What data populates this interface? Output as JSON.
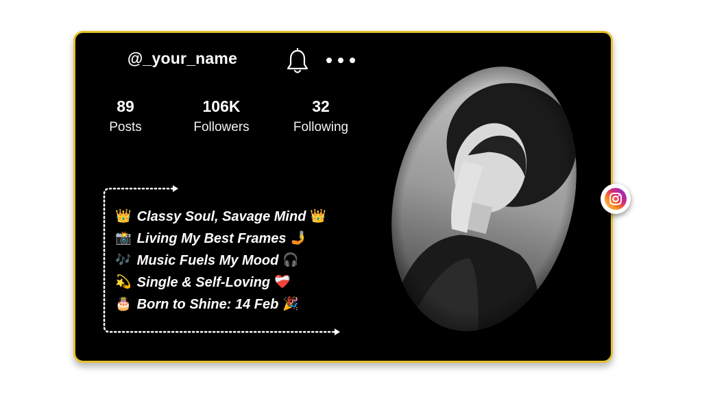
{
  "profile": {
    "username": "@_your_name",
    "stats": [
      {
        "value": "89",
        "label": "Posts"
      },
      {
        "value": "106K",
        "label": "Followers"
      },
      {
        "value": "32",
        "label": "Following"
      }
    ]
  },
  "bio": [
    {
      "lead": "👑",
      "text": "Classy Soul, Savage Mind",
      "trail": "👑"
    },
    {
      "lead": "📸",
      "text": "Living My Best Frames",
      "trail": "🤳"
    },
    {
      "lead": "🎶",
      "text": "Music Fuels My Mood",
      "trail": "🎧"
    },
    {
      "lead": "💫",
      "text": "Single & Self-Loving",
      "trail": "❤️‍🩹"
    },
    {
      "lead": "🎂",
      "text": "Born to Shine: 14 Feb",
      "trail": "🎉"
    }
  ],
  "icons": {
    "bell": "bell-icon",
    "more": "more-options-icon",
    "social": "instagram-icon"
  },
  "colors": {
    "card_background": "#000000",
    "card_border": "#e5c22d",
    "text": "#ffffff"
  }
}
